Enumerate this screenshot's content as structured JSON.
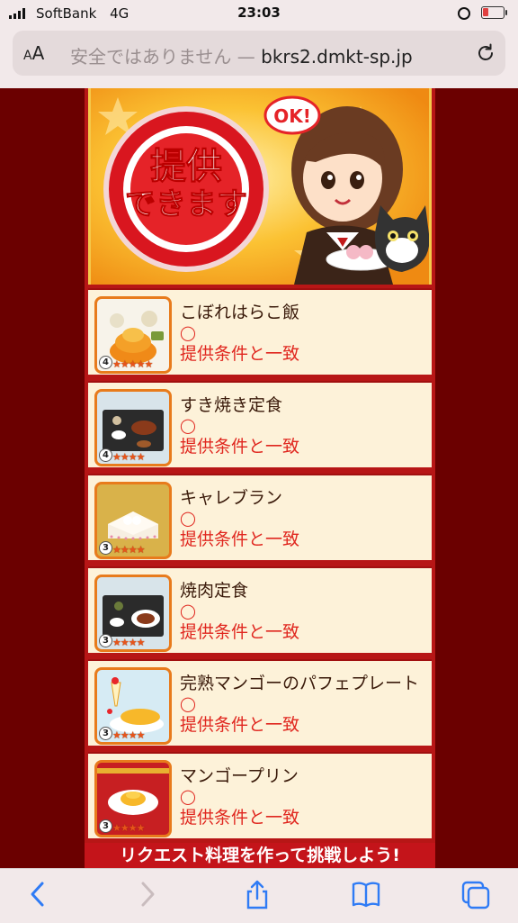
{
  "status_bar": {
    "carrier": "SoftBank",
    "network": "4G",
    "time": "23:03",
    "battery_level": 0.3
  },
  "address_bar": {
    "aa_small": "A",
    "aa_large": "A",
    "security_text": "安全ではありません —",
    "domain": "bkrs2.dmkt-sp.jp",
    "reload_icon": "reload-icon"
  },
  "banner": {
    "line1": "提供",
    "line2": "できます",
    "ok_label": "OK!"
  },
  "dishes": [
    {
      "name": "こぼれはらこ飯",
      "mark": "◯",
      "status": "提供条件と一致",
      "grade": "4",
      "stars": "★★★★★",
      "star_rating": 5
    },
    {
      "name": "すき焼き定食",
      "mark": "◯",
      "status": "提供条件と一致",
      "grade": "4",
      "stars": "★★★★",
      "star_rating": 4
    },
    {
      "name": "キャレブラン",
      "mark": "◯",
      "status": "提供条件と一致",
      "grade": "3",
      "stars": "★★★★",
      "star_rating": 4
    },
    {
      "name": "焼肉定食",
      "mark": "◯",
      "status": "提供条件と一致",
      "grade": "3",
      "stars": "★★★★",
      "star_rating": 4
    },
    {
      "name": "完熟マンゴーのパフェプレート",
      "mark": "◯",
      "status": "提供条件と一致",
      "grade": "3",
      "stars": "★★★★",
      "star_rating": 4
    },
    {
      "name": "マンゴープリン",
      "mark": "◯",
      "status": "提供条件と一致",
      "grade": "3",
      "stars": "★★★★",
      "star_rating": 4
    }
  ],
  "cta": {
    "label": "リクエスト料理を作って挑戦しよう!"
  },
  "toolbar": {
    "back_icon": "chevron-left-icon",
    "forward_icon": "chevron-right-icon",
    "share_icon": "share-icon",
    "bookmarks_icon": "book-icon",
    "tabs_icon": "tabs-icon"
  },
  "colors": {
    "page_background": "#6b0000",
    "column_red": "#b71616",
    "card_background": "#fdf2d9",
    "status_red": "#e0271f",
    "thumb_border": "#e87b1c",
    "cta_red": "#c4141a"
  }
}
